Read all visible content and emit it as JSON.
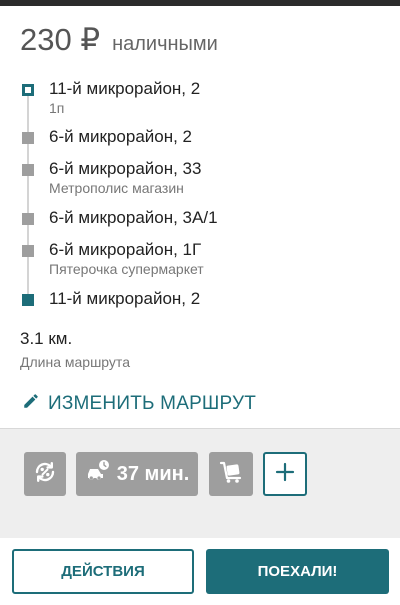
{
  "order": {
    "price": "230 ₽",
    "payment_method": "наличными"
  },
  "route": {
    "stops": [
      {
        "address": "11-й микрорайон, 2",
        "note": "1п",
        "type": "start"
      },
      {
        "address": "6-й микрорайон, 2",
        "note": "",
        "type": "waypoint"
      },
      {
        "address": "6-й микрорайон, 33",
        "note": "Метрополис магазин",
        "type": "waypoint"
      },
      {
        "address": "6-й микрорайон, 3А/1",
        "note": "",
        "type": "waypoint"
      },
      {
        "address": "6-й микрорайон, 1Г",
        "note": "Пятерочка супермаркет",
        "type": "waypoint"
      },
      {
        "address": "11-й микрорайон, 2",
        "note": "",
        "type": "end"
      }
    ],
    "distance": "3.1 км.",
    "distance_label": "Длина маршрута",
    "change_route_label": "ИЗМЕНИТЬ МАРШРУТ"
  },
  "options": {
    "discount_icon": "percent-refresh-icon",
    "time_icon": "car-clock-icon",
    "time_label": "37 мин.",
    "luggage_icon": "luggage-cart-icon",
    "add_icon": "plus-icon"
  },
  "actions": {
    "actions_label": "ДЕЙСТВИЯ",
    "go_label": "ПОЕХАЛИ!"
  },
  "colors": {
    "accent": "#1d6d79",
    "option_bg": "#9e9e9e",
    "section_bg": "#eeeeee"
  }
}
